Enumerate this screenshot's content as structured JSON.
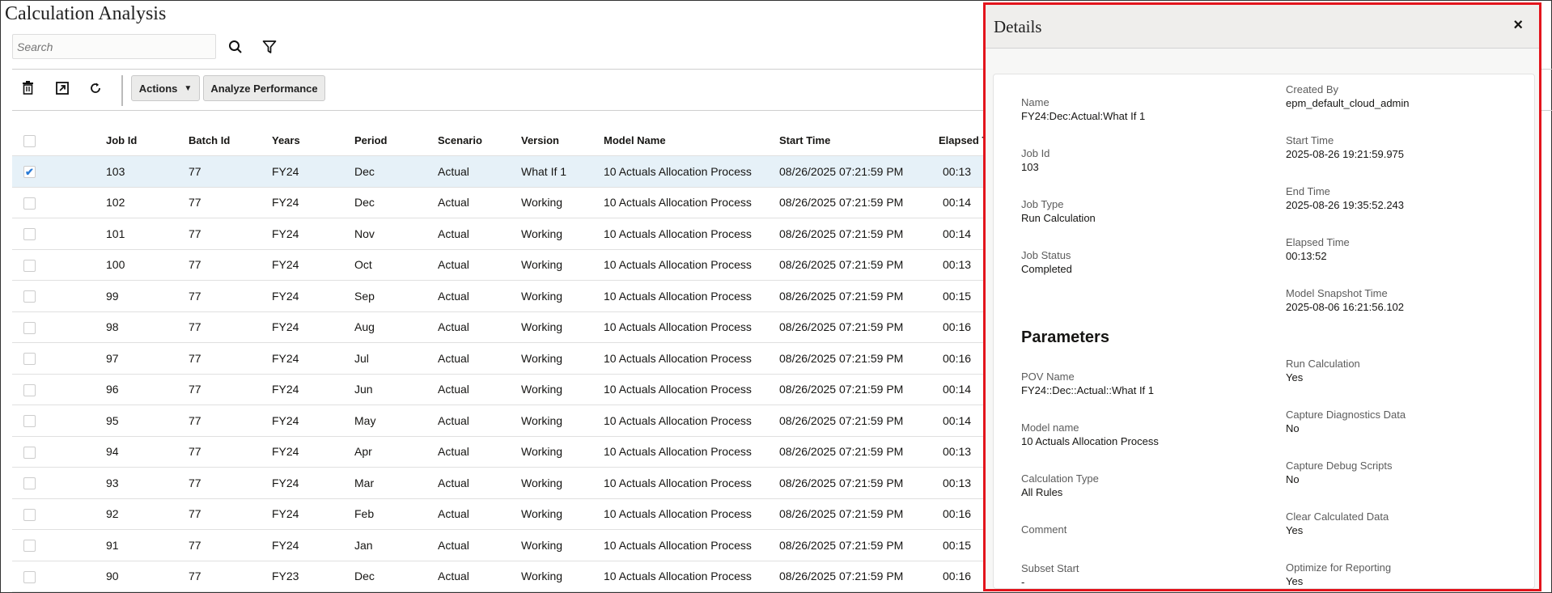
{
  "page": {
    "title": "Calculation Analysis"
  },
  "search": {
    "placeholder": "Search"
  },
  "toolbar": {
    "actions_label": "Actions",
    "analyze_label": "Analyze Performance"
  },
  "table": {
    "columns": [
      "Job Id",
      "Batch Id",
      "Years",
      "Period",
      "Scenario",
      "Version",
      "Model Name",
      "Start Time",
      "Elapsed Ti"
    ],
    "rows": [
      {
        "selected": true,
        "cells": [
          "103",
          "77",
          "FY24",
          "Dec",
          "Actual",
          "What If 1",
          "10 Actuals Allocation Process",
          "08/26/2025 07:21:59 PM",
          "00:13"
        ]
      },
      {
        "selected": false,
        "cells": [
          "102",
          "77",
          "FY24",
          "Dec",
          "Actual",
          "Working",
          "10 Actuals Allocation Process",
          "08/26/2025 07:21:59 PM",
          "00:14"
        ]
      },
      {
        "selected": false,
        "cells": [
          "101",
          "77",
          "FY24",
          "Nov",
          "Actual",
          "Working",
          "10 Actuals Allocation Process",
          "08/26/2025 07:21:59 PM",
          "00:14"
        ]
      },
      {
        "selected": false,
        "cells": [
          "100",
          "77",
          "FY24",
          "Oct",
          "Actual",
          "Working",
          "10 Actuals Allocation Process",
          "08/26/2025 07:21:59 PM",
          "00:13"
        ]
      },
      {
        "selected": false,
        "cells": [
          "99",
          "77",
          "FY24",
          "Sep",
          "Actual",
          "Working",
          "10 Actuals Allocation Process",
          "08/26/2025 07:21:59 PM",
          "00:15"
        ]
      },
      {
        "selected": false,
        "cells": [
          "98",
          "77",
          "FY24",
          "Aug",
          "Actual",
          "Working",
          "10 Actuals Allocation Process",
          "08/26/2025 07:21:59 PM",
          "00:16"
        ]
      },
      {
        "selected": false,
        "cells": [
          "97",
          "77",
          "FY24",
          "Jul",
          "Actual",
          "Working",
          "10 Actuals Allocation Process",
          "08/26/2025 07:21:59 PM",
          "00:16"
        ]
      },
      {
        "selected": false,
        "cells": [
          "96",
          "77",
          "FY24",
          "Jun",
          "Actual",
          "Working",
          "10 Actuals Allocation Process",
          "08/26/2025 07:21:59 PM",
          "00:14"
        ]
      },
      {
        "selected": false,
        "cells": [
          "95",
          "77",
          "FY24",
          "May",
          "Actual",
          "Working",
          "10 Actuals Allocation Process",
          "08/26/2025 07:21:59 PM",
          "00:14"
        ]
      },
      {
        "selected": false,
        "cells": [
          "94",
          "77",
          "FY24",
          "Apr",
          "Actual",
          "Working",
          "10 Actuals Allocation Process",
          "08/26/2025 07:21:59 PM",
          "00:13"
        ]
      },
      {
        "selected": false,
        "cells": [
          "93",
          "77",
          "FY24",
          "Mar",
          "Actual",
          "Working",
          "10 Actuals Allocation Process",
          "08/26/2025 07:21:59 PM",
          "00:13"
        ]
      },
      {
        "selected": false,
        "cells": [
          "92",
          "77",
          "FY24",
          "Feb",
          "Actual",
          "Working",
          "10 Actuals Allocation Process",
          "08/26/2025 07:21:59 PM",
          "00:16"
        ]
      },
      {
        "selected": false,
        "cells": [
          "91",
          "77",
          "FY24",
          "Jan",
          "Actual",
          "Working",
          "10 Actuals Allocation Process",
          "08/26/2025 07:21:59 PM",
          "00:15"
        ]
      },
      {
        "selected": false,
        "cells": [
          "90",
          "77",
          "FY23",
          "Dec",
          "Actual",
          "Working",
          "10 Actuals Allocation Process",
          "08/26/2025 07:21:59 PM",
          "00:16"
        ]
      }
    ]
  },
  "details": {
    "title": "Details",
    "close_label": "×",
    "left": [
      {
        "label": "Name",
        "value": "FY24:Dec:Actual:What If 1"
      },
      {
        "label": "Job Id",
        "value": "103"
      },
      {
        "label": "Job Type",
        "value": "Run Calculation"
      },
      {
        "label": "Job Status",
        "value": "Completed"
      }
    ],
    "right": [
      {
        "label": "Created By",
        "value": "epm_default_cloud_admin"
      },
      {
        "label": "Start Time",
        "value": "2025-08-26 19:21:59.975"
      },
      {
        "label": "End Time",
        "value": "2025-08-26 19:35:52.243"
      },
      {
        "label": "Elapsed Time",
        "value": "00:13:52"
      },
      {
        "label": "Model Snapshot Time",
        "value": "2025-08-06 16:21:56.102"
      }
    ],
    "parameters_heading": "Parameters",
    "params_left": [
      {
        "label": "POV Name",
        "value": "FY24::Dec::Actual::What If 1"
      },
      {
        "label": "Model name",
        "value": "10 Actuals Allocation Process"
      },
      {
        "label": "Calculation Type",
        "value": "All Rules"
      },
      {
        "label": "Comment",
        "value": ""
      },
      {
        "label": "Subset Start",
        "value": "-"
      }
    ],
    "params_right": [
      {
        "label": "Run Calculation",
        "value": "Yes"
      },
      {
        "label": "Capture Diagnostics Data",
        "value": "No"
      },
      {
        "label": "Capture Debug Scripts",
        "value": "No"
      },
      {
        "label": "Clear Calculated Data",
        "value": "Yes"
      },
      {
        "label": "Optimize for Reporting",
        "value": "Yes"
      }
    ]
  },
  "colors": {
    "selected_row": "#e6f1f8",
    "panel_border": "#e3141c",
    "check": "#2a7bd6"
  }
}
